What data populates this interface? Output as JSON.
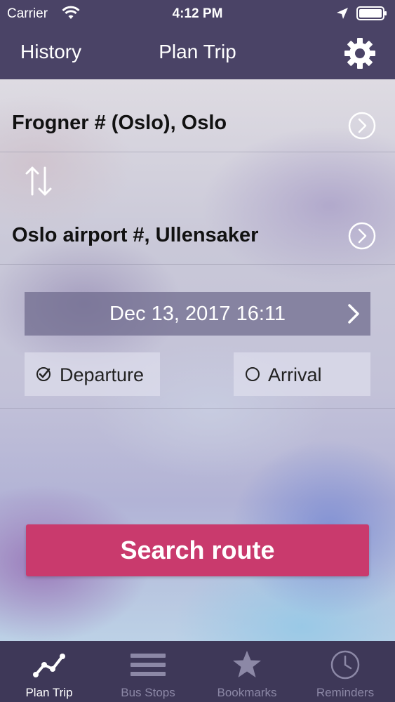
{
  "status_bar": {
    "carrier": "Carrier",
    "time": "4:12 PM"
  },
  "nav": {
    "left_label": "History",
    "title": "Plan Trip",
    "settings_icon": "gear-icon"
  },
  "trip": {
    "from": "Frogner # (Oslo), Oslo",
    "to": "Oslo airport #, Ullensaker",
    "swap_icon": "swap-arrows-icon"
  },
  "datetime": {
    "value": "Dec 13, 2017 16:11"
  },
  "mode": {
    "departure_label": "Departure",
    "arrival_label": "Arrival",
    "selected": "departure"
  },
  "search_button": {
    "label": "Search route"
  },
  "tabs": [
    {
      "label": "Plan Trip",
      "icon": "route-icon",
      "active": true
    },
    {
      "label": "Bus Stops",
      "icon": "list-icon",
      "active": false
    },
    {
      "label": "Bookmarks",
      "icon": "star-icon",
      "active": false
    },
    {
      "label": "Reminders",
      "icon": "clock-icon",
      "active": false
    }
  ],
  "colors": {
    "header": "#4a4366",
    "tabbar": "#3e3858",
    "search_button": "#c93a6d",
    "tab_active": "#ffffff",
    "tab_inactive": "#8c88a6"
  }
}
